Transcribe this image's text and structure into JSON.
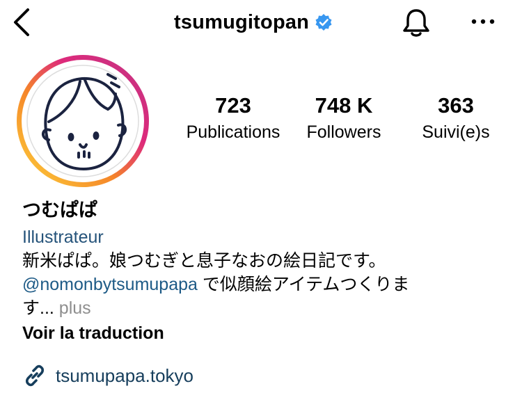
{
  "header": {
    "username": "tsumugitopan",
    "verified": true
  },
  "profile": {
    "stats": [
      {
        "value": "723",
        "label": "Publications"
      },
      {
        "value": "748 K",
        "label": "Followers"
      },
      {
        "value": "363",
        "label": "Suivi(e)s"
      }
    ],
    "display_name": "つむぱぱ",
    "category": "Illustrateur",
    "bio_line1": "新米ぱぱ。娘つむぎと息子なおの絵日記です。",
    "bio_mention": "@nomonbytsumupapa",
    "bio_line2_rest": " で似顔絵アイテムつくりま",
    "bio_line3": "す...",
    "more_label": "plus",
    "translate_label": "Voir la traduction",
    "website": "tsumupapa.tokyo"
  },
  "icons": {
    "back": "chevron-left-icon",
    "verified": "verified-badge-icon",
    "notifications": "bell-icon",
    "more": "more-horizontal-icon",
    "link": "link-icon"
  },
  "colors": {
    "verified_blue": "#3897f0",
    "category_blue": "#25537a",
    "mention_blue": "#1d5a86",
    "link_blue": "#163e5c",
    "muted": "#8e8e8e"
  }
}
